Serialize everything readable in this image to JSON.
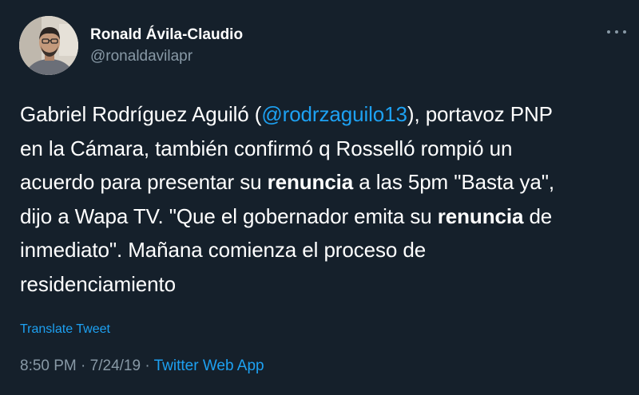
{
  "author": {
    "display_name": "Ronald Ávila-Claudio",
    "handle": "@ronaldavilapr",
    "avatar_icon": "profile-photo"
  },
  "more_icon": "more-dots-icon",
  "tweet": {
    "line1_before": "Gabriel Rodríguez Aguiló (",
    "mention": "@rodrzaguilo13",
    "line1_after": "), portavoz PNP",
    "line2": "en la Cámara, también confirmó q Rosselló rompió un",
    "line3_before": "acuerdo para presentar su ",
    "bold1": "renuncia",
    "line3_after": " a las 5pm \"Basta ya\",",
    "line4_before": "dijo a Wapa TV. \"Que el gobernador emita su ",
    "bold2": "renuncia",
    "line4_after": " de",
    "line5": "inmediato\". Mañana comienza el proceso de",
    "line6": "residenciamiento"
  },
  "translate_label": "Translate Tweet",
  "meta": {
    "time": "8:50 PM",
    "separator1": " · ",
    "date": "7/24/19",
    "separator2": " · ",
    "source": "Twitter Web App"
  },
  "colors": {
    "background": "#15202b",
    "text": "#ffffff",
    "secondary": "#8899a6",
    "accent": "#1da1f2"
  }
}
